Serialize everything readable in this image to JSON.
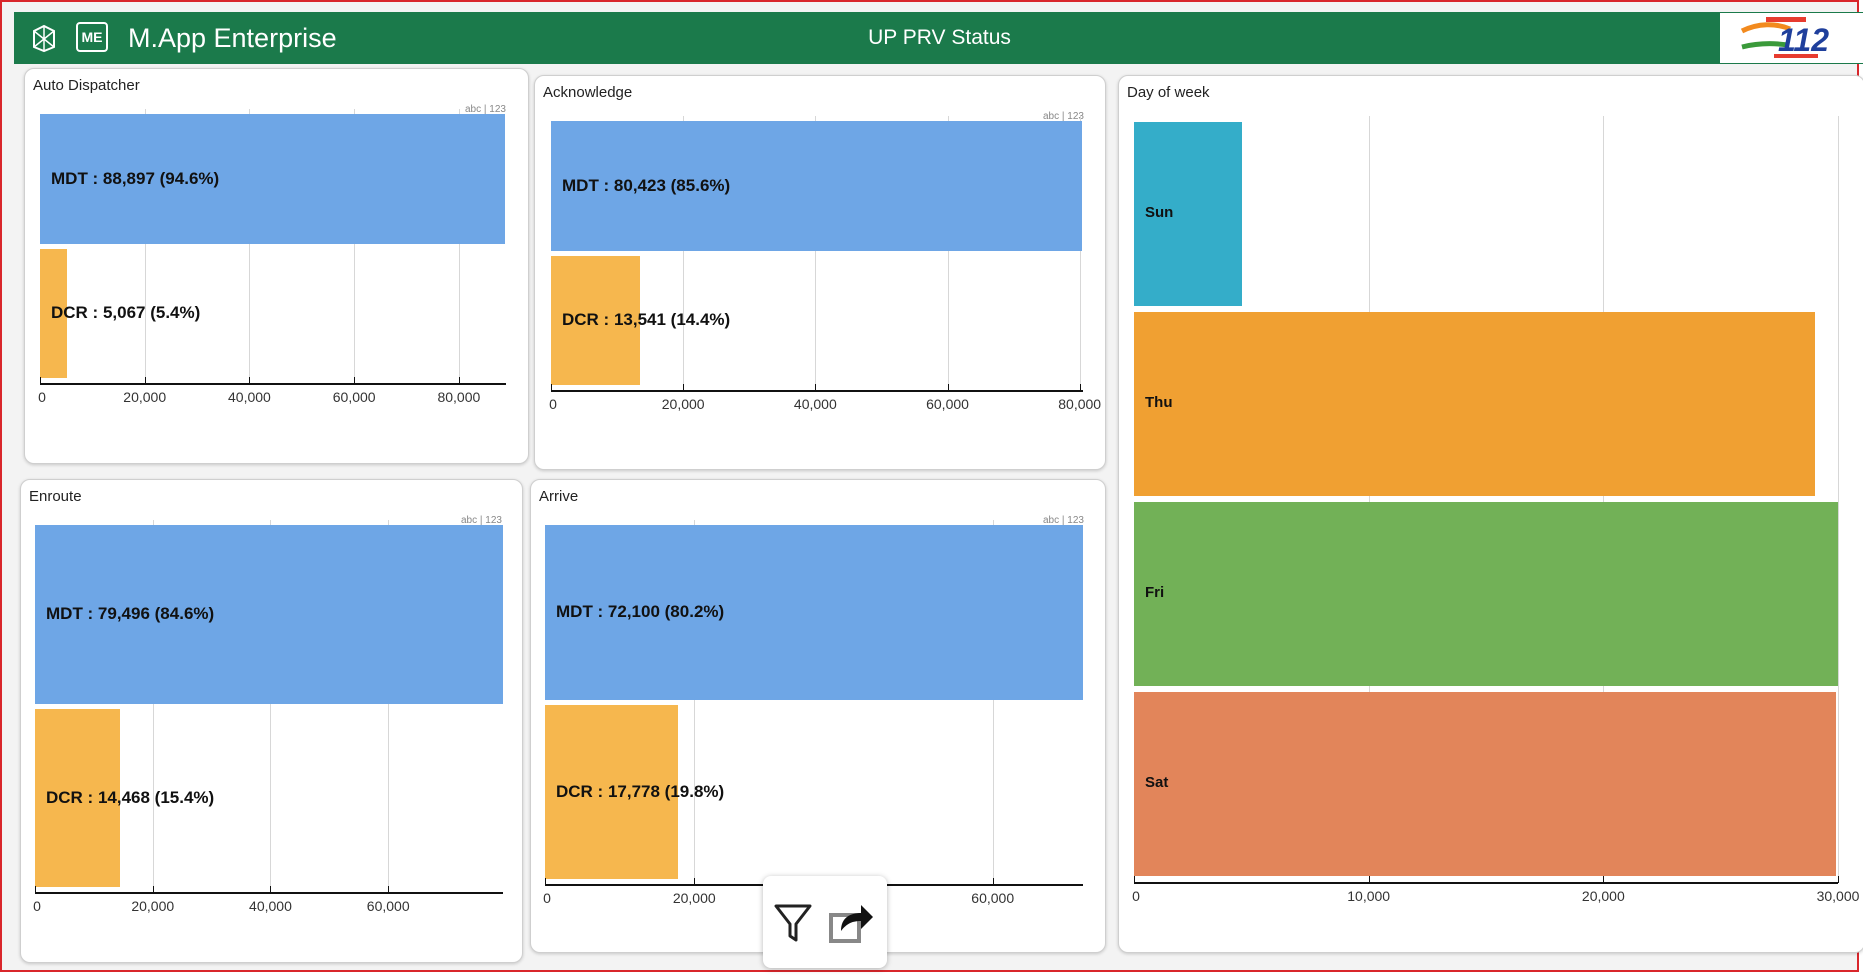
{
  "header": {
    "app_title": "M.App Enterprise",
    "me_badge": "ME",
    "page_title": "UP PRV Status",
    "brand_number": "112",
    "colors": {
      "header_bg": "#1b7a4b",
      "mdt": "#6ea6e6",
      "dcr": "#f6b74e"
    }
  },
  "charts": [
    {
      "id": "auto-dispatcher",
      "title": "Auto Dispatcher",
      "tag": "abc | 123",
      "type": "bar",
      "xlim": [
        0,
        89000
      ],
      "ticks": [
        0,
        20000,
        40000,
        60000,
        80000
      ],
      "tick_labels": [
        "0",
        "20,000",
        "40,000",
        "60,000",
        "80,000"
      ],
      "series": [
        {
          "label": "MDT : 88,897 (94.6%)",
          "value": 88897,
          "color": "#6ea6e6"
        },
        {
          "label": "DCR : 5,067 (5.4%)",
          "value": 5067,
          "color": "#f6b74e"
        }
      ]
    },
    {
      "id": "acknowledge",
      "title": "Acknowledge",
      "tag": "abc | 123",
      "type": "bar",
      "xlim": [
        0,
        80500
      ],
      "ticks": [
        0,
        20000,
        40000,
        60000,
        80000
      ],
      "tick_labels": [
        "0",
        "20,000",
        "40,000",
        "60,000",
        "80,000"
      ],
      "series": [
        {
          "label": "MDT : 80,423 (85.6%)",
          "value": 80423,
          "color": "#6ea6e6"
        },
        {
          "label": "DCR : 13,541 (14.4%)",
          "value": 13541,
          "color": "#f6b74e"
        }
      ]
    },
    {
      "id": "enroute",
      "title": "Enroute",
      "tag": "abc | 123",
      "type": "bar",
      "xlim": [
        0,
        79500
      ],
      "ticks": [
        0,
        20000,
        40000,
        60000
      ],
      "tick_labels": [
        "0",
        "20,000",
        "40,000",
        "60,000"
      ],
      "series": [
        {
          "label": "MDT : 79,496 (84.6%)",
          "value": 79496,
          "color": "#6ea6e6"
        },
        {
          "label": "DCR : 14,468 (15.4%)",
          "value": 14468,
          "color": "#f6b74e"
        }
      ]
    },
    {
      "id": "arrive",
      "title": "Arrive",
      "tag": "abc | 123",
      "type": "bar",
      "xlim": [
        0,
        72100
      ],
      "ticks": [
        0,
        20000,
        60000
      ],
      "tick_labels": [
        "0",
        "20,000",
        "60,000"
      ],
      "series": [
        {
          "label": "MDT : 72,100 (80.2%)",
          "value": 72100,
          "color": "#6ea6e6"
        },
        {
          "label": "DCR : 17,778 (19.8%)",
          "value": 17778,
          "color": "#f6b74e"
        }
      ]
    }
  ],
  "chart_data": {
    "type": "bar",
    "title": "Day of week",
    "categories": [
      "Sun",
      "Thu",
      "Fri",
      "Sat"
    ],
    "values": [
      4600,
      29000,
      30500,
      29900
    ],
    "colors": [
      "#34adc9",
      "#f0a032",
      "#72b157",
      "#e2855a"
    ],
    "xlim": [
      0,
      30000
    ],
    "ticks": [
      0,
      10000,
      20000,
      30000
    ],
    "tick_labels": [
      "0",
      "10,000",
      "20,000",
      "30,000"
    ]
  },
  "toolbar": {
    "filter_icon": "filter-icon",
    "share_icon": "share-icon"
  }
}
